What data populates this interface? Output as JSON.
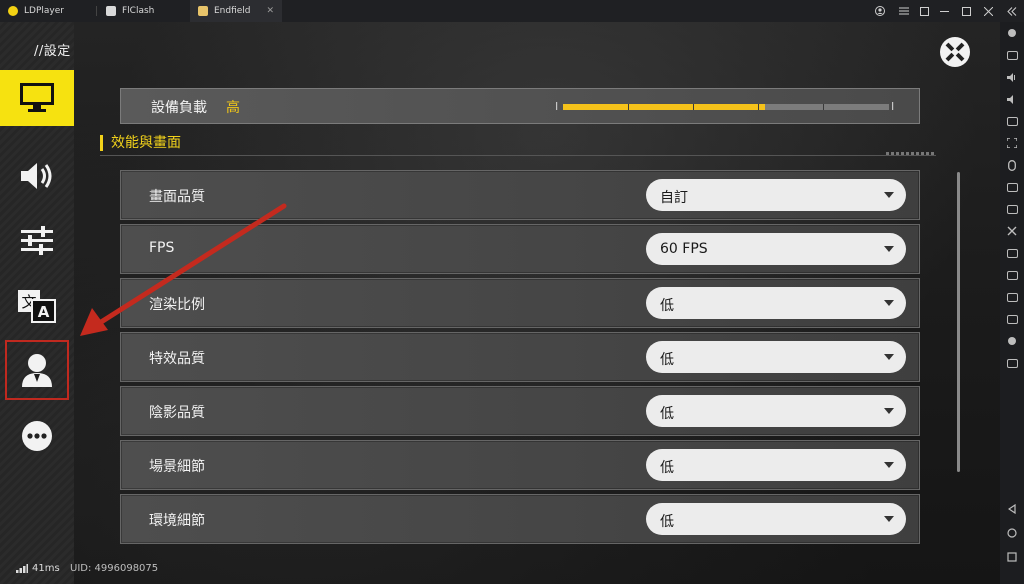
{
  "titlebar": {
    "tabs": [
      {
        "label": "LDPlayer",
        "icon": "ldplayer-logo-icon",
        "color": "#f4d213"
      },
      {
        "label": "FlClash",
        "icon": "flclash-logo-icon",
        "color": "#d9d9d9"
      },
      {
        "label": "Endfield",
        "icon": "endfield-logo-icon",
        "color": "#e8c46a"
      }
    ],
    "close_tab_glyph": "✕"
  },
  "game": {
    "page_title": "//設定",
    "nav_items": [
      {
        "name": "display-icon",
        "active": true
      },
      {
        "name": "speaker-icon",
        "active": false
      },
      {
        "name": "sliders-icon",
        "active": false
      },
      {
        "name": "language-icon",
        "active": false
      },
      {
        "name": "account-icon",
        "active": false,
        "highlighted": true
      },
      {
        "name": "more-icon",
        "active": false
      }
    ],
    "device_load": {
      "label": "設備負載",
      "value": "高",
      "level": 0.62,
      "accent": "#f5c21a"
    },
    "section_title": "效能與畫面",
    "settings": [
      {
        "label": "畫面品質",
        "value": "自訂"
      },
      {
        "label": "FPS",
        "value": "60 FPS"
      },
      {
        "label": "渲染比例",
        "value": "低"
      },
      {
        "label": "特效品質",
        "value": "低"
      },
      {
        "label": "陰影品質",
        "value": "低"
      },
      {
        "label": "場景細節",
        "value": "低"
      },
      {
        "label": "環境細節",
        "value": "低"
      }
    ],
    "footer": {
      "ping": "41ms",
      "uid": "UID: 4996098075"
    }
  }
}
